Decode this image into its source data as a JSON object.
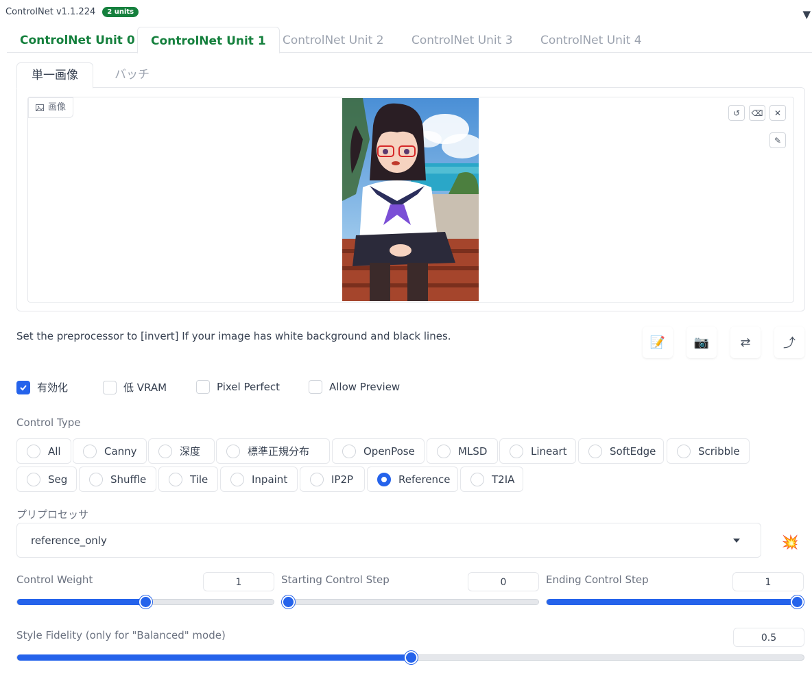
{
  "header": {
    "title": "ControlNet v1.1.224",
    "units_badge": "2 units",
    "collapse_icon": "triangle-down-icon"
  },
  "unit_tabs": [
    {
      "label": "ControlNet Unit 0",
      "state": "enabled"
    },
    {
      "label": "ControlNet Unit 1",
      "state": "selected"
    },
    {
      "label": "ControlNet Unit 2",
      "state": "inactive"
    },
    {
      "label": "ControlNet Unit 3",
      "state": "inactive"
    },
    {
      "label": "ControlNet Unit 4",
      "state": "inactive"
    }
  ],
  "sub_tabs": [
    {
      "label": "単一画像",
      "selected": true
    },
    {
      "label": "バッチ",
      "selected": false
    }
  ],
  "image_panel": {
    "label": "画像",
    "image_icon": "image-icon",
    "tools": [
      "undo-icon",
      "eraser-icon",
      "close-icon",
      "brush-icon"
    ]
  },
  "hint": "Set the preprocessor to [invert] If your image has white background and black lines.",
  "action_buttons": [
    {
      "icon": "notepad-icon",
      "glyph": "📝"
    },
    {
      "icon": "camera-icon",
      "glyph": "📷"
    },
    {
      "icon": "swap-icon",
      "glyph": "⇄"
    },
    {
      "icon": "send-arrow-icon",
      "glyph": "⤴"
    }
  ],
  "checkboxes": [
    {
      "label": "有効化",
      "checked": true
    },
    {
      "label": "低 VRAM",
      "checked": false
    },
    {
      "label": "Pixel Perfect",
      "checked": false
    },
    {
      "label": "Allow Preview",
      "checked": false
    }
  ],
  "control_type": {
    "label": "Control Type",
    "options": [
      "All",
      "Canny",
      "深度",
      "標準正規分布",
      "OpenPose",
      "MLSD",
      "Lineart",
      "SoftEdge",
      "Scribble",
      "Seg",
      "Shuffle",
      "Tile",
      "Inpaint",
      "IP2P",
      "Reference",
      "T2IA"
    ],
    "selected": "Reference"
  },
  "preprocessor": {
    "label": "プリプロセッサ",
    "value": "reference_only",
    "run_icon": "explosion-icon",
    "run_glyph": "💥"
  },
  "sliders": [
    {
      "label": "Control Weight",
      "value": "1",
      "fraction": 0.5
    },
    {
      "label": "Starting Control Step",
      "value": "0",
      "fraction": 0.0
    },
    {
      "label": "Ending Control Step",
      "value": "1",
      "fraction": 1.0
    }
  ],
  "style_fidelity": {
    "label": "Style Fidelity (only for \"Balanced\" mode)",
    "value": "0.5",
    "fraction": 0.5
  },
  "colors": {
    "accent": "#2563eb",
    "green": "#15803d",
    "border": "#e5e7eb"
  }
}
